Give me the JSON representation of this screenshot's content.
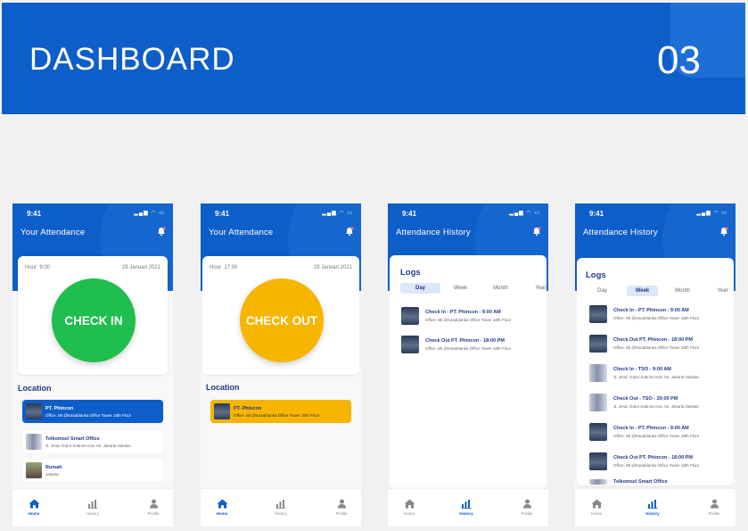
{
  "banner": {
    "title": "DASHBOARD",
    "number": "03"
  },
  "colors": {
    "primary": "#0e5ec9",
    "check_in": "#1fbe4e",
    "check_out": "#f8b500"
  },
  "status_bar": {
    "time": "9:41",
    "icons": "signal-wifi-battery"
  },
  "nav": {
    "home": "Home",
    "history": "History",
    "profile": "Profile"
  },
  "screens": [
    {
      "title": "Your Attendance",
      "hour": "Hour: 9:00",
      "date": "29 Januari 2021",
      "button": "CHECK IN",
      "section": "Location",
      "locations": [
        {
          "name": "PT. Phincon",
          "address": "Office. 88 @Kasablanka Office Tower 18th Floor"
        },
        {
          "name": "Telkomsel Smart Office",
          "address": "Jl. Jend. Gatot Subroto Kav. 52. Jakarta Selatan"
        },
        {
          "name": "Rumah",
          "address": "Jakarta"
        }
      ]
    },
    {
      "title": "Your Attendance",
      "hour": "Hour: 17:00",
      "date": "29 Januari 2021",
      "button": "CHECK OUT",
      "section": "Location",
      "locations": [
        {
          "name": "PT. Phincon",
          "address": "Office. 88 @Kasablanka Office Tower 18th Floor"
        }
      ]
    },
    {
      "title": "Attendance History",
      "logs_title": "Logs",
      "tabs": [
        "Day",
        "Week",
        "Month",
        "Year"
      ],
      "logs": [
        {
          "title": "Check In - PT. Phincon - 9:00 AM",
          "address": "Office. 88 @Kasablanka Office Tower 18th Floor"
        },
        {
          "title": "Check Out PT. Phincon - 18:00 PM",
          "address": "Office. 88 @Kasablanka Office Tower 18th Floor"
        }
      ]
    },
    {
      "title": "Attendance History",
      "logs_title": "Logs",
      "tabs": [
        "Day",
        "Week",
        "Month",
        "Year"
      ],
      "logs": [
        {
          "title": "Check In - PT. Phincon - 9:00 AM",
          "address": "Office. 88 @Kasablanka Office Tower 18th Floor"
        },
        {
          "title": "Check Out PT. Phincon - 18:00 PM",
          "address": "Office. 88 @Kasablanka Office Tower 18th Floor"
        },
        {
          "title": "Check In - TSO - 9:00 AM",
          "address": "Jl. Jend. Gatot Subroto Kav. 52. Jakarta Selatan"
        },
        {
          "title": "Check Out - TSO - 20:00 PM",
          "address": "Jl. Jend. Gatot Subroto Kav. 52. Jakarta Selatan"
        },
        {
          "title": "Check In - PT. Phincon - 9:00 AM",
          "address": "Office. 88 @Kasablanka Office Tower 18th Floor"
        },
        {
          "title": "Check Out PT. Phincon - 18:00 PM",
          "address": "Office. 88 @Kasablanka Office Tower 18th Floor"
        },
        {
          "title": "Telkomsel Smart Office",
          "address": ""
        }
      ]
    }
  ]
}
